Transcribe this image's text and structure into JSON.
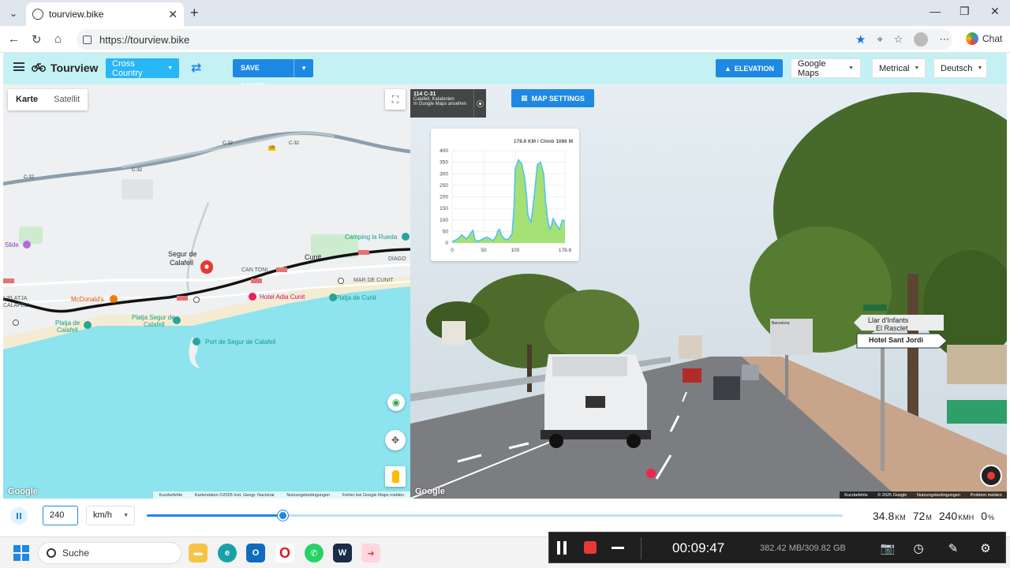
{
  "browser": {
    "tab_title": "tourview.bike",
    "url": "https://tourview.bike",
    "chat_label": "Chat"
  },
  "toolbar": {
    "brand": "Tourview",
    "route_type": "Cross Country",
    "save_route": "SAVE ROUTE",
    "elevation": "ELEVATION",
    "map_provider": "Google Maps",
    "units": "Metrical",
    "language": "Deutsch"
  },
  "map": {
    "tabs": [
      "Karte",
      "Satellit"
    ],
    "labels": {
      "c32_a": "C-32",
      "c32_b": "C-32",
      "c32_c": "C-32",
      "c32_d": "C-32",
      "badge_19": "19",
      "camping": "Camping la Rueda",
      "slide": "Slide",
      "segur_1": "Segur de",
      "segur_2": "Calafell",
      "can_toni": "CAN TONI",
      "cunit": "Cunit",
      "diagonal": "DIAGO",
      "mar_de_cunit": "MAR DE CUNIT",
      "mcdonalds": "McDonald's",
      "hotel_adia": "Hotel Adia Cunit",
      "platja_cunit": "Platja de Cunit",
      "platja_segur_1": "Platja Segur de",
      "platja_segur_2": "Calafell",
      "platja_de_1": "Platja de",
      "platja_de_2": "Calafell",
      "port": "Port de Segur de Calafell",
      "lplatja": "L'PLATJA",
      "calafell_left": "CALAFELL"
    },
    "google_logo": "Google",
    "attribution": [
      "Kurzbefehle",
      "Kartendaten ©2025 Inst. Geogr. Nacional",
      "Nutzungsbedingungen",
      "Fehler bei Google Maps melden"
    ]
  },
  "streetview": {
    "info": {
      "road": "114 C-31",
      "place": "Calafell, Katalonien",
      "link": "In Google Maps ansehen"
    },
    "map_settings": "MAP SETTINGS",
    "google_logo": "Google",
    "attribution": [
      "Kurzbefehle",
      "© 2025 Google",
      "Nutzungsbedingungen",
      "Problem melden"
    ],
    "signs": {
      "llar": "Llar d'Infants",
      "rasclet": "El Rasclet",
      "hotel": "Hotel Sant Jordi",
      "barcelona": "Barcelona"
    }
  },
  "chart_data": {
    "type": "area",
    "title": "178.8 KM / Climb 1086 M",
    "x_ticks": [
      "0",
      "50",
      "100",
      "178.8"
    ],
    "y_ticks": [
      "0",
      "50",
      "100",
      "150",
      "200",
      "250",
      "300",
      "350",
      "400"
    ],
    "ylim": [
      0,
      400
    ],
    "xlim": [
      0,
      178.8
    ],
    "x": [
      0,
      5,
      10,
      15,
      18,
      22,
      25,
      30,
      33,
      36,
      40,
      45,
      50,
      55,
      60,
      65,
      70,
      72,
      75,
      78,
      82,
      86,
      90,
      95,
      98,
      100,
      105,
      110,
      115,
      118,
      120,
      125,
      130,
      135,
      140,
      145,
      148,
      152,
      155,
      158,
      160,
      165,
      170,
      175,
      178.8
    ],
    "values": [
      5,
      12,
      20,
      35,
      30,
      18,
      25,
      45,
      55,
      15,
      8,
      12,
      20,
      25,
      18,
      10,
      30,
      50,
      60,
      35,
      20,
      15,
      18,
      40,
      150,
      320,
      360,
      345,
      280,
      200,
      120,
      90,
      200,
      340,
      350,
      300,
      180,
      90,
      60,
      80,
      105,
      80,
      60,
      100,
      95
    ],
    "line_color": "#4fc3f7",
    "fill_color": "#a5e075",
    "grid": true
  },
  "playback": {
    "speed_value": "240",
    "speed_unit": "km/h",
    "progress_fraction": 0.195,
    "stats": [
      {
        "value": "34.8",
        "unit": "KM"
      },
      {
        "value": "72",
        "unit": "M"
      },
      {
        "value": "240",
        "unit": "KMH"
      },
      {
        "value": "0",
        "unit": "%"
      }
    ]
  },
  "taskbar": {
    "search_placeholder": "Suche"
  },
  "recorder": {
    "time": "00:09:47",
    "storage": "382.42 MB/309.82 GB"
  }
}
